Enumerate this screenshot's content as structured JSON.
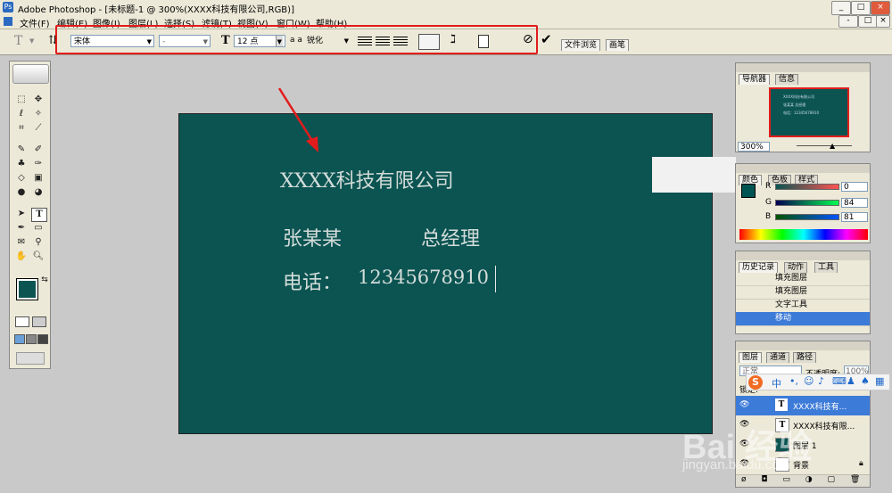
{
  "window": {
    "title": "Adobe Photoshop - [未标题-1 @ 300%(XXXX科技有限公司,RGB)]",
    "buttons": [
      "_",
      "□",
      "×"
    ],
    "doc_buttons": [
      "-",
      "□",
      "×"
    ]
  },
  "menubar": [
    "文件(F)",
    "编辑(E)",
    "图像(I)",
    "图层(L)",
    "选择(S)",
    "滤镜(T)",
    "视图(V)",
    "窗口(W)",
    "帮助(H)"
  ],
  "options": {
    "font_family": "宋体",
    "font_style": "-",
    "font_size_prefix": "T",
    "font_size": "12 点",
    "aa_prefix": "a a",
    "antialias": "锐化",
    "tabs": [
      "文件浏览",
      "画笔"
    ]
  },
  "card": {
    "company": "XXXX科技有限公司",
    "name": "张某某",
    "position": "总经理",
    "phone_label": "电话：",
    "phone": "12345678910"
  },
  "navigator": {
    "tabs": [
      "导航器",
      "信息"
    ],
    "zoom": "300%",
    "thumb_lines": [
      "XXXX科技有限公司",
      "张某某    总经理",
      "电话：12345678910"
    ]
  },
  "color_panel": {
    "tabs": [
      "颜色",
      "色板",
      "样式"
    ],
    "channels": [
      {
        "label": "R",
        "value": "0"
      },
      {
        "label": "G",
        "value": "84"
      },
      {
        "label": "B",
        "value": "81"
      }
    ],
    "foreground": "#005451"
  },
  "history": {
    "tabs": [
      "历史记录",
      "动作",
      "工具"
    ],
    "items": [
      "填充图层",
      "填充图层",
      "文字工具",
      "移动"
    ]
  },
  "layers": {
    "tabs": [
      "图层",
      "通道",
      "路径"
    ],
    "blend": "正常",
    "opacity_label": "不透明度:",
    "opacity": "100%",
    "lock_label": "锁定:",
    "rows": [
      "XXXX科技有...",
      "XXXX科技有限...",
      "图层 1",
      "背景"
    ]
  },
  "ime": {
    "logo": "S",
    "lang": "中",
    "icons": [
      "ime-punct-icon",
      "emoji-icon",
      "mic-icon",
      "keyboard-icon",
      "user-icon",
      "skin-icon",
      "grid-icon"
    ]
  },
  "watermark": {
    "brand": "Bai 经验",
    "site": "jingyan.baidu.com"
  },
  "colors": {
    "canvas": "#0b5452",
    "highlight": "#e21c1c",
    "selected": "#3d7bd8"
  }
}
